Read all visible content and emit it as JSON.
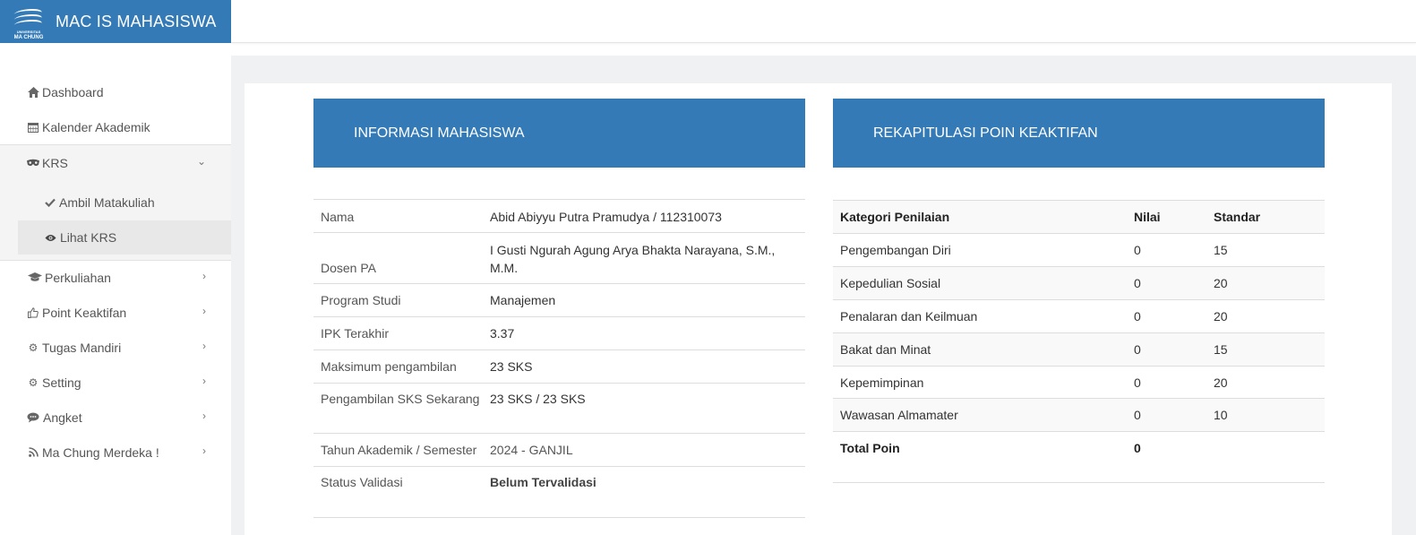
{
  "app": {
    "title": "MAC IS MAHASISWA",
    "logo_line1": "UNIVERSITAS",
    "logo_line2": "MA CHUNG",
    "brand_color": "#337ab7"
  },
  "sidebar": {
    "items": [
      {
        "label": "Dashboard",
        "icon": "home-icon"
      },
      {
        "label": "Kalender Akademik",
        "icon": "calendar-icon"
      },
      {
        "label": "KRS",
        "icon": "mask-icon",
        "expanded": true,
        "children": [
          {
            "label": "Ambil Matakuliah",
            "icon": "check-icon"
          },
          {
            "label": "Lihat KRS",
            "icon": "eye-icon",
            "active": true
          }
        ]
      },
      {
        "label": "Perkuliahan",
        "icon": "graduation-cap-icon"
      },
      {
        "label": "Point Keaktifan",
        "icon": "thumbs-up-icon"
      },
      {
        "label": "Tugas Mandiri",
        "icon": "gear-icon"
      },
      {
        "label": "Setting",
        "icon": "gear-icon"
      },
      {
        "label": "Angket",
        "icon": "comment-icon"
      },
      {
        "label": "Ma Chung Merdeka !",
        "icon": "rss-icon"
      }
    ]
  },
  "info": {
    "title": "INFORMASI MAHASISWA",
    "rows": [
      {
        "key": "Nama",
        "value": "Abid Abiyyu Putra Pramudya / 112310073"
      },
      {
        "key": "Dosen PA",
        "value": "I Gusti Ngurah Agung Arya Bhakta Narayana, S.M., M.M."
      },
      {
        "key": "Program Studi",
        "value": "Manajemen"
      },
      {
        "key": "IPK Terakhir",
        "value": "3.37"
      },
      {
        "key": "Maksimum pengambilan",
        "value": "23 SKS"
      },
      {
        "key": "Pengambilan SKS Sekarang",
        "value": "23 SKS / 23 SKS"
      },
      {
        "key": "Tahun Akademik / Semester",
        "value": "2024 - GANJIL"
      },
      {
        "key": "Status Validasi",
        "value": "Belum Tervalidasi"
      }
    ]
  },
  "rekap": {
    "title": "REKAPITULASI POIN KEAKTIFAN",
    "headers": [
      "Kategori Penilaian",
      "Nilai",
      "Standar"
    ],
    "rows": [
      [
        "Pengembangan Diri",
        "0",
        "15"
      ],
      [
        "Kepedulian Sosial",
        "0",
        "20"
      ],
      [
        "Penalaran dan Keilmuan",
        "0",
        "20"
      ],
      [
        "Bakat dan Minat",
        "0",
        "15"
      ],
      [
        "Kepemimpinan",
        "0",
        "20"
      ],
      [
        "Wawasan Almamater",
        "0",
        "10"
      ]
    ],
    "total_label": "Total Poin",
    "total_value": "0"
  }
}
